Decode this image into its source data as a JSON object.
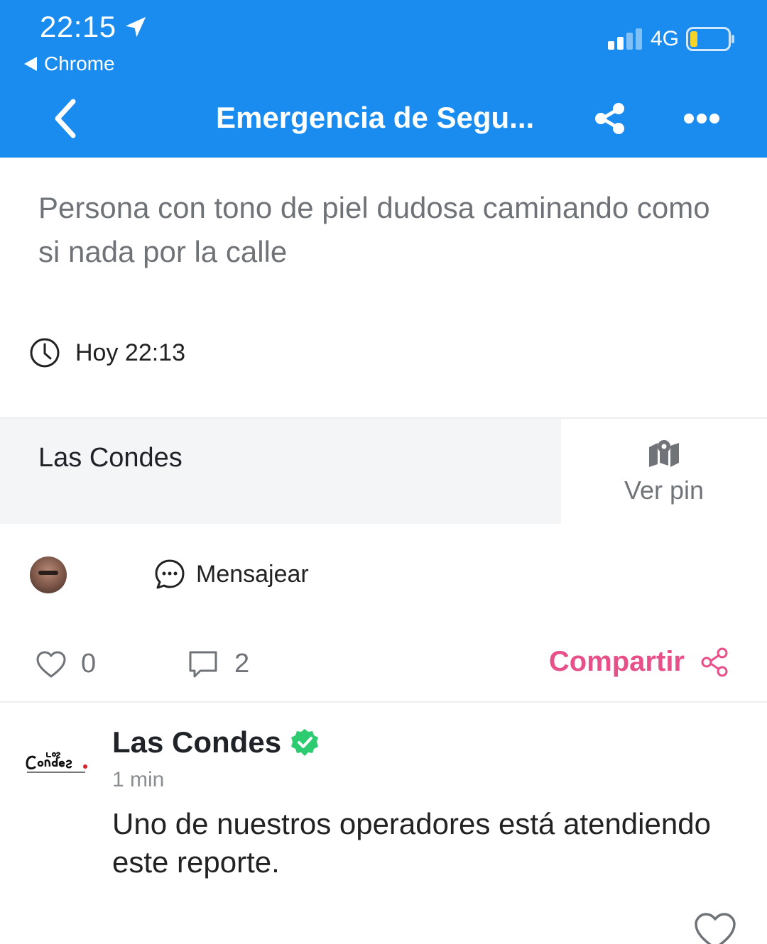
{
  "status_bar": {
    "time": "22:15",
    "back_app": "Chrome",
    "network": "4G"
  },
  "nav": {
    "title": "Emergencia de Segu..."
  },
  "post": {
    "text": "Persona con tono de piel dudosa caminando como si nada por la calle",
    "timestamp": "Hoy 22:13"
  },
  "location": {
    "name": "Las Condes",
    "pin_label": "Ver pin"
  },
  "author": {
    "message_label": "Mensajear"
  },
  "actions": {
    "likes": "0",
    "comments": "2",
    "share_label": "Compartir"
  },
  "comment": {
    "author": "Las Condes",
    "time": "1 min",
    "text": "Uno de nuestros operadores está atendiendo este reporte."
  },
  "colors": {
    "header_bg": "#1a8cf0",
    "share_accent": "#e8508a",
    "verified_badge": "#2ecc71"
  }
}
